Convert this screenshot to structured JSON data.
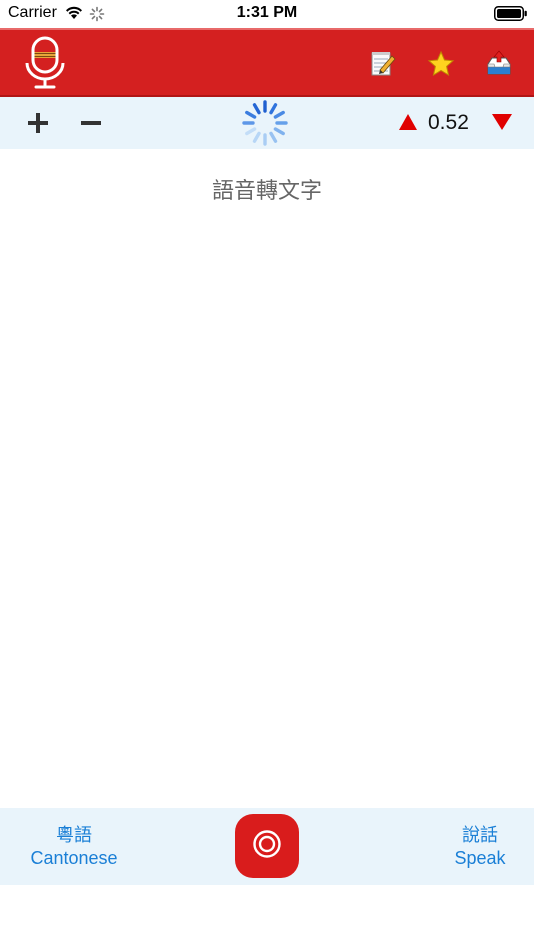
{
  "status_bar": {
    "carrier": "Carrier",
    "time": "1:31 PM"
  },
  "header": {
    "background_color": "#d42020",
    "logo_icon": "microphone-icon",
    "actions": [
      {
        "name": "notes",
        "icon": "notepad-pencil-icon"
      },
      {
        "name": "favorites",
        "icon": "star-icon"
      },
      {
        "name": "share",
        "icon": "inbox-upload-icon"
      }
    ]
  },
  "toolbar": {
    "zoom_in_label": "+",
    "zoom_out_label": "−",
    "rate_value": "0.52",
    "accent_color": "#e00000"
  },
  "content": {
    "placeholder": "語音轉文字"
  },
  "bottom_bar": {
    "left_button": {
      "line1": "粵語",
      "line2": "Cantonese"
    },
    "right_button": {
      "line1": "說話",
      "line2": "Speak"
    },
    "link_color": "#1a7fd6",
    "record_color": "#d91c1c"
  }
}
